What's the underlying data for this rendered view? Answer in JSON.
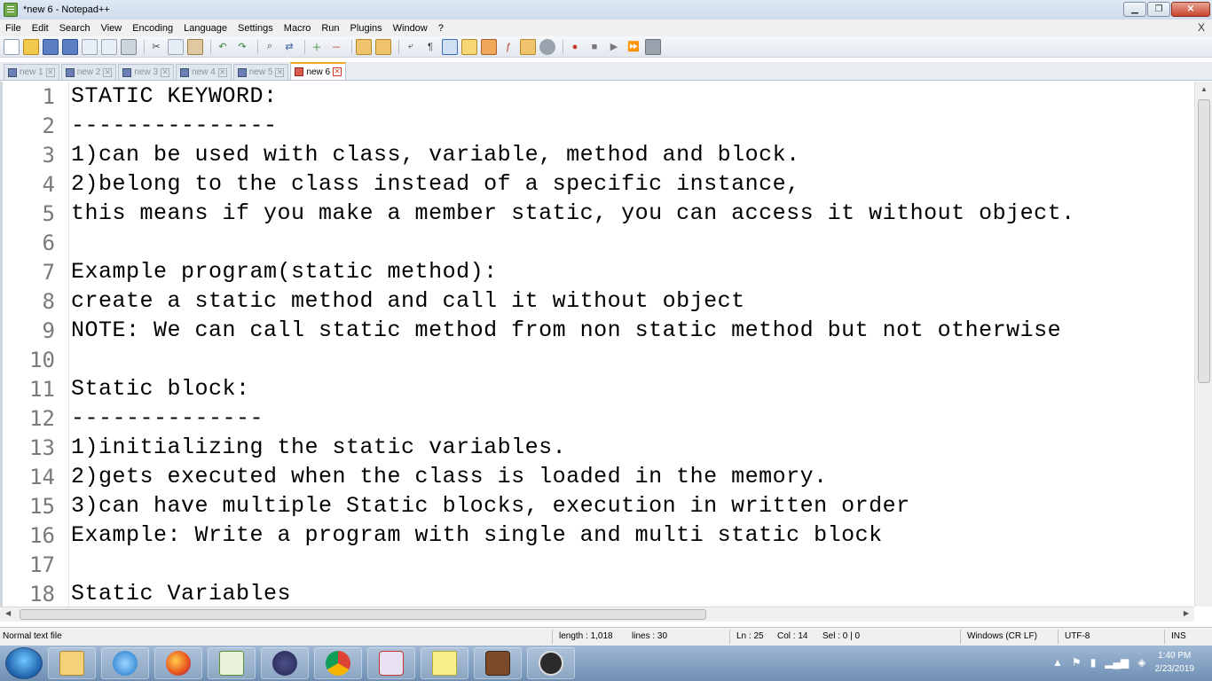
{
  "window": {
    "title": "*new 6 - Notepad++",
    "controls": {
      "minimize": "▁",
      "restore": "❐",
      "close": "✕"
    }
  },
  "menu": {
    "items": [
      "File",
      "Edit",
      "Search",
      "View",
      "Encoding",
      "Language",
      "Settings",
      "Macro",
      "Run",
      "Plugins",
      "Window",
      "?"
    ],
    "close_glyph": "X"
  },
  "tabs": [
    {
      "label": "new 1",
      "active": false
    },
    {
      "label": "new 2",
      "active": false
    },
    {
      "label": "new 3",
      "active": false
    },
    {
      "label": "new 4",
      "active": false
    },
    {
      "label": "new 5",
      "active": false
    },
    {
      "label": "new 6",
      "active": true
    }
  ],
  "editor": {
    "lines": [
      {
        "num": "1",
        "text": "STATIC KEYWORD:"
      },
      {
        "num": "2",
        "text": "---------------"
      },
      {
        "num": "3",
        "text": "1)can be used with class, variable, method and block."
      },
      {
        "num": "4",
        "text": "2)belong to the class instead of a specific instance,"
      },
      {
        "num": "5",
        "text": "this means if you make a member static, you can access it without object."
      },
      {
        "num": "6",
        "text": ""
      },
      {
        "num": "7",
        "text": "Example program(static method):"
      },
      {
        "num": "8",
        "text": "create a static method and call it without object"
      },
      {
        "num": "9",
        "text": "NOTE: We can call static method from non static method but not otherwise"
      },
      {
        "num": "10",
        "text": ""
      },
      {
        "num": "11",
        "text": "Static block:"
      },
      {
        "num": "12",
        "text": "--------------"
      },
      {
        "num": "13",
        "text": "1)initializing the static variables."
      },
      {
        "num": "14",
        "text": "2)gets executed when the class is loaded in the memory."
      },
      {
        "num": "15",
        "text": "3)can have multiple Static blocks, execution in written order"
      },
      {
        "num": "16",
        "text": "Example: Write a program with single and multi static block"
      },
      {
        "num": "17",
        "text": ""
      },
      {
        "num": "18",
        "text": "Static Variables"
      }
    ]
  },
  "status": {
    "file_type": "Normal text file",
    "length": "length : 1,018",
    "lines": "lines : 30",
    "ln": "Ln : 25",
    "col": "Col : 14",
    "sel": "Sel : 0 | 0",
    "eol": "Windows (CR LF)",
    "encoding": "UTF-8",
    "mode": "INS"
  },
  "taskbar": {
    "icons": [
      "start-orb-icon",
      "folder-icon",
      "ie-icon",
      "firefox-icon",
      "notepadpp-icon",
      "eclipse-icon",
      "chrome-icon",
      "snipping-tool-icon",
      "sticky-notes-icon",
      "app-icon",
      "obs-icon"
    ],
    "time": "1:40 PM",
    "date": "2/23/2019"
  },
  "colors": {
    "accent_tab": "#f5a623",
    "line_number": "#7a7a7a",
    "taskbar": "#6f8fb3"
  }
}
